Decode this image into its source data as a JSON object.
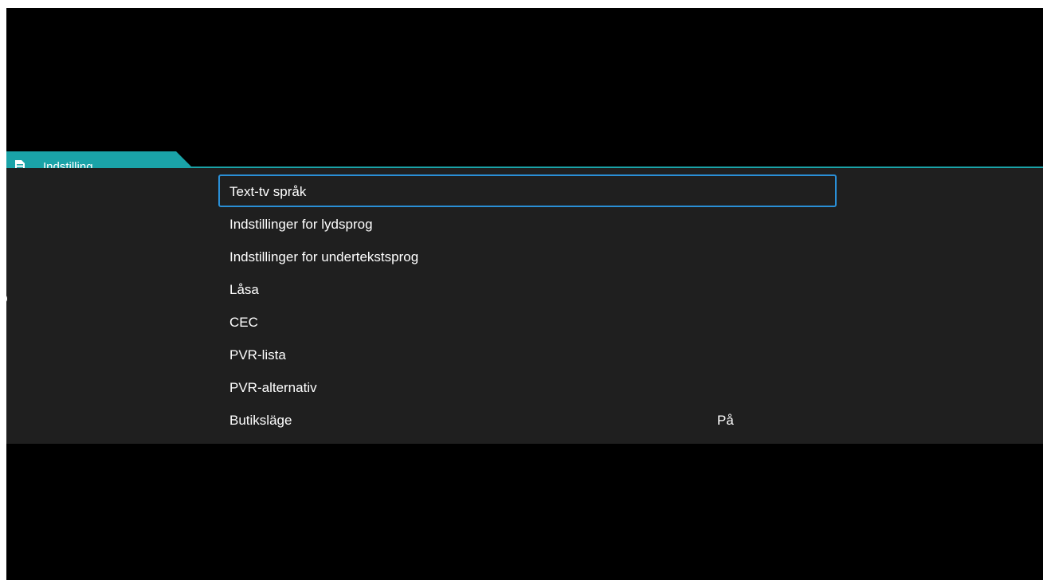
{
  "colors": {
    "screen_background": "#000000",
    "panel_background": "#1f1f1f",
    "tab_accent": "#1aa3a8",
    "selection_border": "#2a8fd6",
    "text": "#ffffff"
  },
  "header_tab": {
    "icon": "document-list-icon",
    "label": "Indstilling"
  },
  "menu": {
    "selected_index": 0,
    "items": [
      {
        "label": "Text-tv språk",
        "value": ""
      },
      {
        "label": "Indstillinger for lydsprog",
        "value": ""
      },
      {
        "label": "Indstillinger for undertekstsprog",
        "value": ""
      },
      {
        "label": "Låsa",
        "value": ""
      },
      {
        "label": "CEC",
        "value": ""
      },
      {
        "label": "PVR-lista",
        "value": ""
      },
      {
        "label": "PVR-alternativ",
        "value": ""
      },
      {
        "label": "Butiksläge",
        "value": "På"
      }
    ]
  }
}
